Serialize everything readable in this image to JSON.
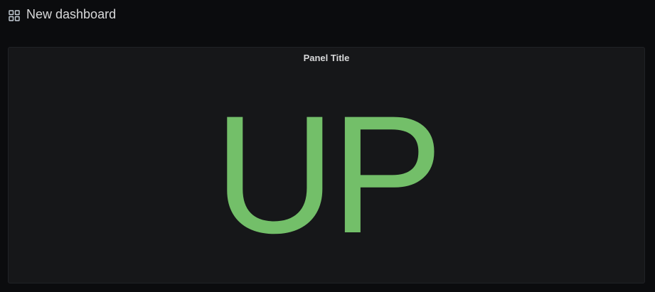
{
  "header": {
    "icon": "apps-grid-icon",
    "title": "New dashboard"
  },
  "panel": {
    "title": "Panel Title",
    "value": "UP",
    "value_color": "#73bf69"
  },
  "colors": {
    "background": "#0b0c0e",
    "panel_background": "#161719",
    "text": "#d8d9da"
  }
}
